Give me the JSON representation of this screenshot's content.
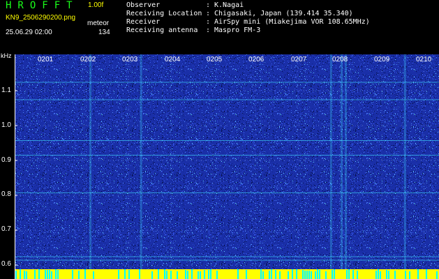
{
  "header": {
    "app_title": "HROFFT",
    "version": "1.00f",
    "filename": "KN9_2506290200.png",
    "mode_label": "meteor",
    "timestamp": "25.06.29 02:00",
    "count": "134"
  },
  "info": [
    {
      "key": "Observer",
      "value": "K.Nagai"
    },
    {
      "key": "Receiving Location",
      "value": "Chigasaki, Japan (139.414 35.340)"
    },
    {
      "key": "Receiver",
      "value": "AirSpy mini (Miakejima VOR 108.65MHz)"
    },
    {
      "key": "Receiving antenna",
      "value": "Maspro FM-3"
    }
  ],
  "separator": ":",
  "colors": {
    "title_green": "#1aff1a",
    "label_yellow": "#ffff00",
    "spectrogram_base": "#1a2fa8",
    "echo_cyan": "#40e0ff",
    "strip_yellow": "#ffff00",
    "strip_cyan": "#00ffff"
  },
  "chart_data": {
    "type": "heatmap",
    "ylabel": "kHz",
    "y_ticks": [
      "1.1",
      "1.0",
      "0.9",
      "0.8",
      "0.7",
      "0.6"
    ],
    "y_tick_values": [
      1.1,
      1.0,
      0.9,
      0.8,
      0.7,
      0.6
    ],
    "ylim": [
      0.58,
      1.18
    ],
    "x_ticks": [
      "0201",
      "0202",
      "0203",
      "0204",
      "0205",
      "0206",
      "0207",
      "0208",
      "0209",
      "0210"
    ],
    "x_tick_values": [
      1,
      2,
      3,
      4,
      5,
      6,
      7,
      8,
      9,
      10
    ],
    "xlim": [
      0.6,
      10.55
    ],
    "grid": true,
    "vertical_bands": [
      2.1,
      3.3,
      7.8,
      8.05,
      8.15,
      9.55
    ],
    "horizontal_lines": [
      1.125,
      1.075,
      0.958,
      0.916,
      0.808,
      0.625,
      0.615
    ]
  }
}
